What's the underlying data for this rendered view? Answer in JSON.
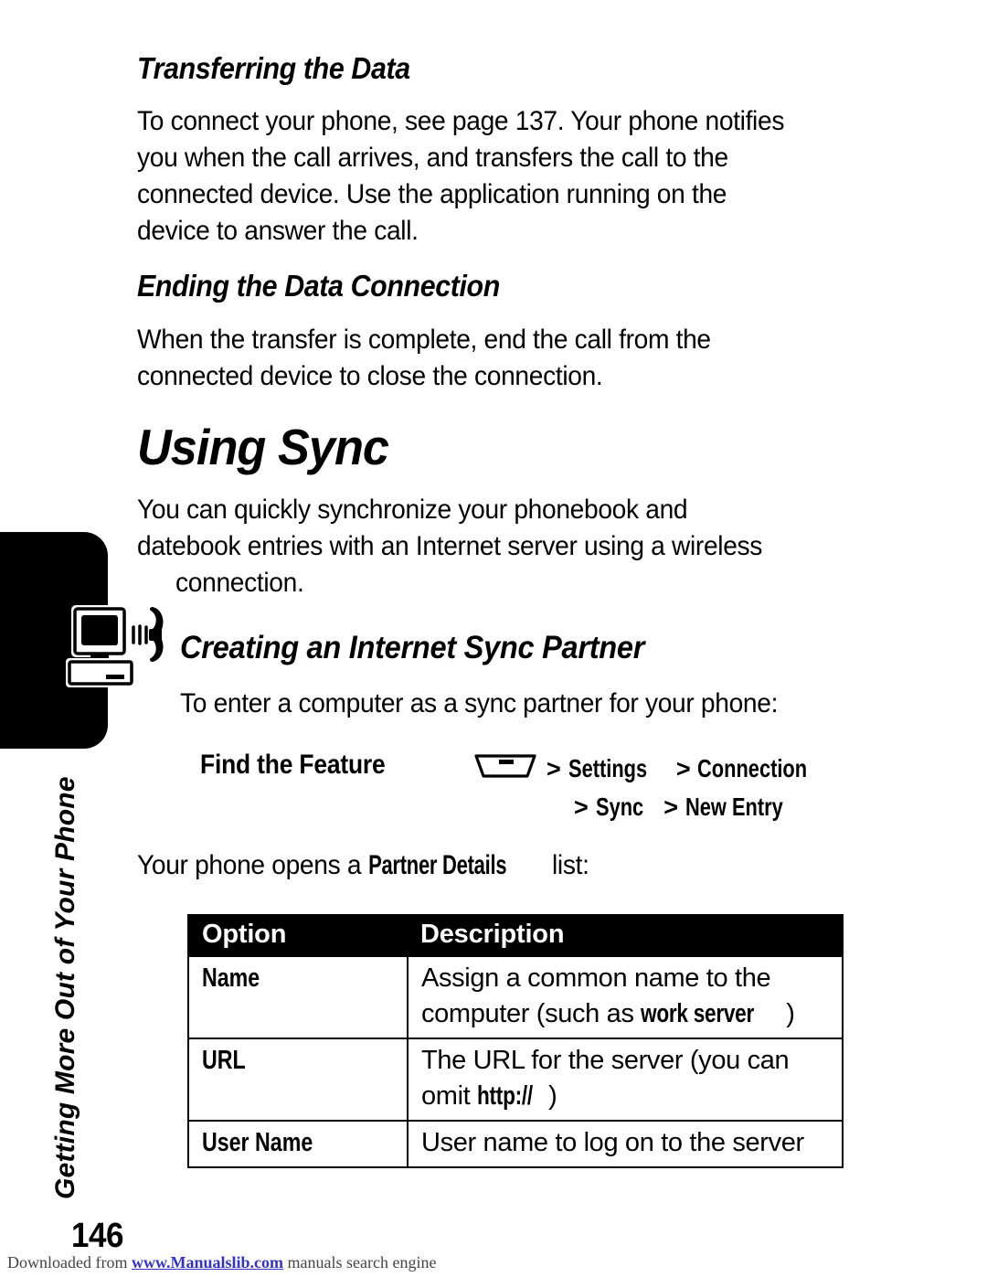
{
  "sidebar": {
    "chapter_title": "Getting More Out of Your Phone",
    "icon_name": "computer-phone-sync-icon"
  },
  "sections": {
    "transferring": {
      "heading": "Transferring the Data",
      "lines": [
        "To connect your phone, see page 137. Your phone notifies",
        "you when the call arrives, and transfers the call to the",
        "connected device. Use the application running on the",
        "device to answer the call."
      ]
    },
    "ending": {
      "heading": "Ending the Data Connection",
      "lines": [
        "When the transfer is complete, end the call from the",
        "connected device to close the connection."
      ]
    },
    "using_sync": {
      "heading": "Using Sync",
      "lines": [
        "You can quickly synchronize your phonebook and",
        "datebook entries with an Internet server using a wireless",
        "connection."
      ]
    },
    "creating_partner": {
      "heading": "Creating an Internet Sync Partner",
      "lines": [
        "To enter a computer as a sync partner for your phone:"
      ]
    }
  },
  "find_the_feature": {
    "label": "Find the Feature",
    "menu_key_icon": "menu-key-icon",
    "path_line1_sep1": ">",
    "path_line1_item1": "Settings",
    "path_line1_sep2": ">",
    "path_line1_item2": "Connection",
    "path_line2_sep1": ">",
    "path_line2_item1": "Sync",
    "path_line2_sep2": ">",
    "path_line2_item2": "New Entry"
  },
  "table_intro": {
    "prefix": "Your phone opens a ",
    "emphasis": "Partner Details",
    "suffix": " list:"
  },
  "table": {
    "headers": [
      "Option",
      "Description"
    ],
    "rows": [
      {
        "option": "Name",
        "description_lines": [
          "Assign a common name to the",
          "computer (such as "
        ],
        "description_emphasis": "work server",
        "description_tail": ")"
      },
      {
        "option": "URL",
        "description_lines": [
          "The URL for the server (you can",
          "omit "
        ],
        "description_emphasis": "http://",
        "description_tail": ")"
      },
      {
        "option": "User Name",
        "description_lines": [
          "User name to log on to the server"
        ],
        "description_emphasis": "",
        "description_tail": ""
      }
    ]
  },
  "page_number": "146",
  "footer": {
    "prefix": "Downloaded from ",
    "link": "www.Manualslib.com",
    "suffix": " manuals search engine"
  },
  "colors": {
    "text": "#000000",
    "background": "#ffffff",
    "table_header_bg": "#000000",
    "table_header_text": "#ffffff",
    "footer_text": "#444444",
    "footer_link": "#3333cc"
  }
}
